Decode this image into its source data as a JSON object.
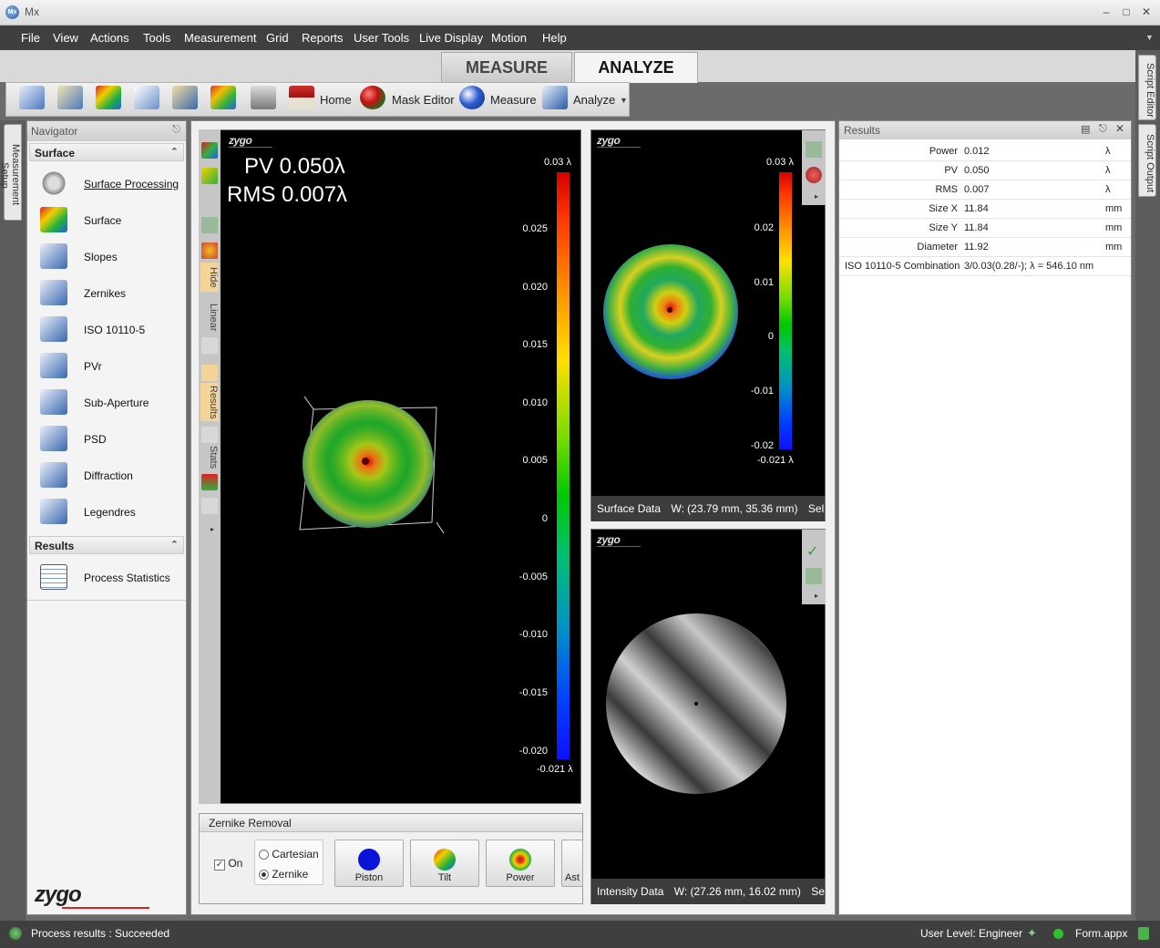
{
  "app": {
    "title": "Mx",
    "icon": "mx-app-icon"
  },
  "menu": [
    "File",
    "View",
    "Actions",
    "Tools",
    "Measurement",
    "Grid",
    "Reports",
    "User Tools",
    "Live Display",
    "Motion",
    "Help"
  ],
  "tabs": {
    "measure": "MEASURE",
    "analyze": "ANALYZE"
  },
  "toolbar": {
    "home": "Home",
    "mask_editor": "Mask Editor",
    "measure": "Measure",
    "analyze": "Analyze"
  },
  "side_tabs": {
    "measurement_setup": "Measurement Setup",
    "script_editor": "Script Editor",
    "script_output": "Script Output"
  },
  "navigator": {
    "title": "Navigator",
    "surface_section": "Surface",
    "surface_items": [
      "Surface Processing",
      "Surface",
      "Slopes",
      "Zernikes",
      "ISO 10110-5",
      "PVr",
      "Sub-Aperture",
      "PSD",
      "Diffraction",
      "Legendres"
    ],
    "results_section": "Results",
    "results_items": [
      "Process Statistics"
    ],
    "logo": "zygo"
  },
  "plot3d": {
    "logo": "zygo",
    "pv": "PV 0.050λ",
    "rms": "RMS 0.007λ",
    "colorbar_max": "0.03 λ",
    "colorbar_min": "-0.021 λ",
    "ticks": [
      "0.025",
      "0.020",
      "0.015",
      "0.010",
      "0.005",
      "0",
      "-0.005",
      "-0.010",
      "-0.015",
      "-0.020"
    ],
    "side_labels": {
      "hide": "Hide",
      "linear": "Linear",
      "results": "Results",
      "stats": "Stats"
    }
  },
  "surface_panel": {
    "logo": "zygo",
    "colorbar_max": "0.03 λ",
    "colorbar_min": "-0.021 λ",
    "ticks": [
      "0.02",
      "0.01",
      "0",
      "-0.01",
      "-0.02"
    ],
    "info_title": "Surface Data",
    "info_coord": "W: (23.79 mm, 35.36 mm)",
    "info_extra": "Sel"
  },
  "intensity_panel": {
    "logo": "zygo",
    "info_title": "Intensity Data",
    "info_coord": "W: (27.26 mm, 16.02 mm)",
    "info_extra": "Se"
  },
  "zernike": {
    "title": "Zernike Removal",
    "on_label": "On",
    "on_checked": true,
    "cartesian": "Cartesian",
    "zernike": "Zernike",
    "buttons": [
      "Piston",
      "Tilt",
      "Power",
      "Ast"
    ]
  },
  "results": {
    "title": "Results",
    "rows": [
      {
        "label": "Power",
        "value": "0.012",
        "unit": "λ"
      },
      {
        "label": "PV",
        "value": "0.050",
        "unit": "λ"
      },
      {
        "label": "RMS",
        "value": "0.007",
        "unit": "λ"
      },
      {
        "label": "Size X",
        "value": "11.84",
        "unit": "mm"
      },
      {
        "label": "Size Y",
        "value": "11.84",
        "unit": "mm"
      },
      {
        "label": "Diameter",
        "value": "11.92",
        "unit": "mm"
      }
    ],
    "iso_label": "ISO 10110-5 Combination",
    "iso_value": "3/0.03(0.28/-); λ = 546.10 nm"
  },
  "status": {
    "message": "Process results : Succeeded",
    "user_level": "User Level: Engineer",
    "file": "Form.appx"
  }
}
